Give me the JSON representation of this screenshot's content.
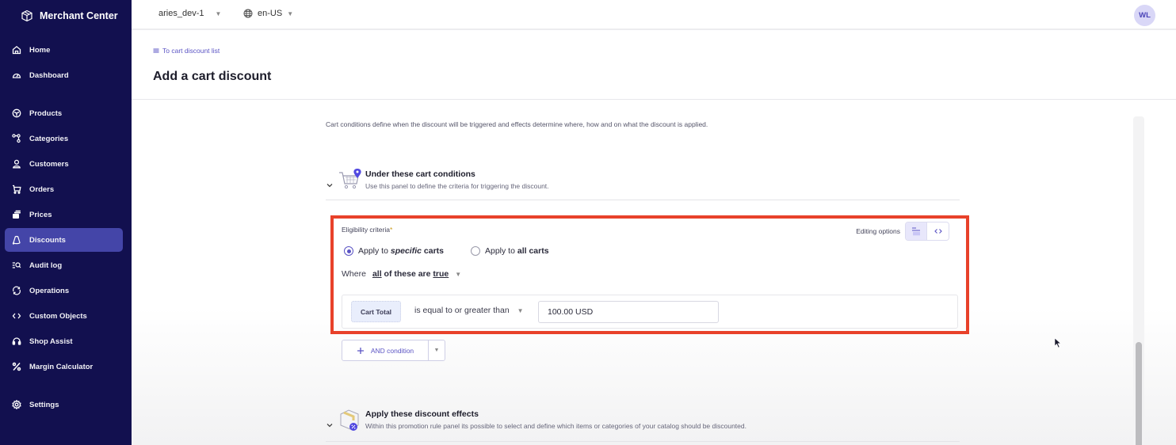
{
  "app": {
    "name": "Merchant Center"
  },
  "sidebar": {
    "items": [
      {
        "label": "Home",
        "icon": "home-icon"
      },
      {
        "label": "Dashboard",
        "icon": "gauge-icon"
      },
      {
        "label": "Products",
        "icon": "cube-icon"
      },
      {
        "label": "Categories",
        "icon": "tree-icon"
      },
      {
        "label": "Customers",
        "icon": "user-icon"
      },
      {
        "label": "Orders",
        "icon": "cart-icon"
      },
      {
        "label": "Prices",
        "icon": "price-stack-icon"
      },
      {
        "label": "Discounts",
        "icon": "discount-bag-icon",
        "active": true
      },
      {
        "label": "Audit log",
        "icon": "audit-search-icon"
      },
      {
        "label": "Operations",
        "icon": "sync-icon"
      },
      {
        "label": "Custom Objects",
        "icon": "code-brackets-icon"
      },
      {
        "label": "Shop Assist",
        "icon": "headset-icon"
      },
      {
        "label": "Margin Calculator",
        "icon": "percent-icon"
      },
      {
        "label": "Settings",
        "icon": "gear-icon"
      }
    ]
  },
  "topbar": {
    "project": "aries_dev-1",
    "locale": "en-US",
    "avatar_initials": "WL"
  },
  "header": {
    "back_link": "To cart discount list",
    "title": "Add a cart discount"
  },
  "main": {
    "intro": "Cart conditions define when the discount will be triggered and effects determine where, how and on what the discount is applied.",
    "conditions_panel": {
      "title": "Under these cart conditions",
      "description": "Use this panel to define the criteria for triggering the discount."
    },
    "eligibility": {
      "label": "Eligibility criteria",
      "required_mark": "*",
      "editing_options_label": "Editing options",
      "radio_specific_prefix": "Apply to ",
      "radio_specific_emph": "specific",
      "radio_specific_suffix": " carts",
      "radio_all_prefix": "Apply to ",
      "radio_all_bold": "all carts",
      "selected": "specific",
      "where_label": "Where",
      "where_all": "all",
      "where_middle": " of these are ",
      "where_true": "true",
      "condition": {
        "field": "Cart Total",
        "operator": "is equal to or greater than",
        "value": "100.00 USD"
      },
      "and_button": "AND condition"
    },
    "effects_panel": {
      "title": "Apply these discount effects",
      "description": "Within this promotion rule panel its possible to select and define which items or categories of your catalog should be discounted."
    }
  },
  "colors": {
    "sidebar_bg": "#12104f",
    "sidebar_active": "#4445a8",
    "accent": "#5b54c4",
    "highlight_border": "#e8412a"
  }
}
